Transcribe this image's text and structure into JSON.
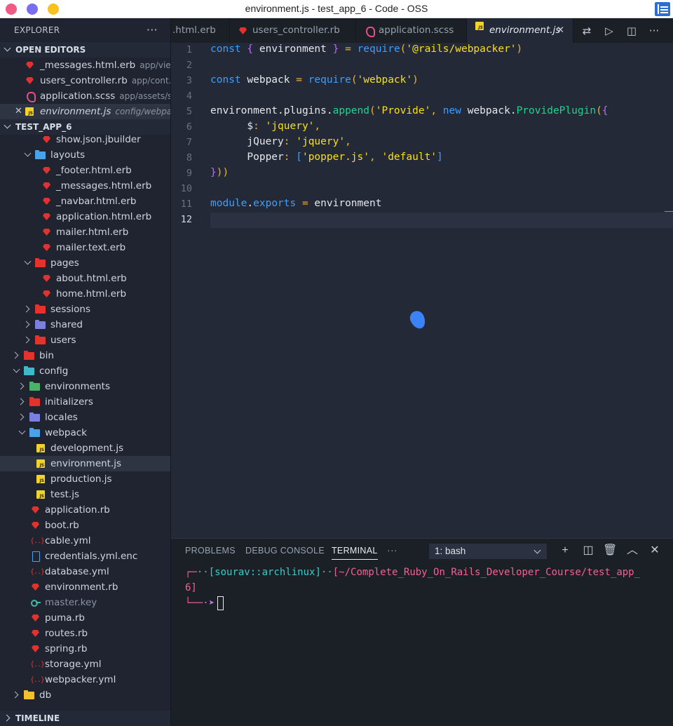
{
  "window": {
    "title": "environment.js - test_app_6 - Code - OSS"
  },
  "sidebar": {
    "header": "EXPLORER",
    "open_editors_title": "OPEN EDITORS",
    "open_editors": [
      {
        "name": "_messages.html.erb",
        "hint": "app/vie..."
      },
      {
        "name": "users_controller.rb",
        "hint": "app/cont..."
      },
      {
        "name": "application.scss",
        "hint": "app/assets/s..."
      },
      {
        "name": "environment.js",
        "hint": "config/webpa..."
      }
    ],
    "project_title": "TEST_APP_6",
    "tree": [
      "show.json.jbuilder",
      "layouts",
      "_footer.html.erb",
      "_messages.html.erb",
      "_navbar.html.erb",
      "application.html.erb",
      "mailer.html.erb",
      "mailer.text.erb",
      "pages",
      "about.html.erb",
      "home.html.erb",
      "sessions",
      "shared",
      "users",
      "bin",
      "config",
      "environments",
      "initializers",
      "locales",
      "webpack",
      "development.js",
      "environment.js",
      "production.js",
      "test.js",
      "application.rb",
      "boot.rb",
      "cable.yml",
      "credentials.yml.enc",
      "database.yml",
      "environment.rb",
      "master.key",
      "puma.rb",
      "routes.rb",
      "spring.rb",
      "storage.yml",
      "webpacker.yml",
      "db"
    ],
    "timeline_title": "TIMELINE"
  },
  "tabs": [
    {
      "label": ".html.erb"
    },
    {
      "label": "users_controller.rb"
    },
    {
      "label": "application.scss"
    },
    {
      "label": "environment.js"
    }
  ],
  "editor": {
    "line_numbers": [
      "1",
      "2",
      "3",
      "4",
      "5",
      "6",
      "7",
      "8",
      "9",
      "10",
      "11",
      "12"
    ],
    "lines": [
      "const { environment } = require('@rails/webpacker')",
      "",
      "const webpack = require('webpack')",
      "",
      "environment.plugins.append('Provide', new webpack.ProvidePlugin({",
      "      $: 'jquery',",
      "      jQuery: 'jquery',",
      "      Popper: ['popper.js', 'default']",
      "}))",
      "",
      "module.exports = environment",
      ""
    ]
  },
  "panel": {
    "tabs": [
      "PROBLEMS",
      "DEBUG CONSOLE",
      "TERMINAL"
    ],
    "more": "···",
    "terminal_select": "1: bash",
    "terminal": {
      "corner": "┌",
      "dash1": "─",
      "dots1": "··",
      "user": "[sourav::archlinux]",
      "dots2": "··",
      "path_a": "[~/Complete_Ruby_On_Rails_Developer_Course/test_app_",
      "path_b": "6]",
      "prompt_corner": "└",
      "prompt_dash": "──",
      "prompt_dot": "·",
      "prompt_arrow": "➤"
    }
  },
  "colors": {
    "accent": "#3aa0ff",
    "string": "#f8e01a",
    "function": "#24d28c"
  }
}
